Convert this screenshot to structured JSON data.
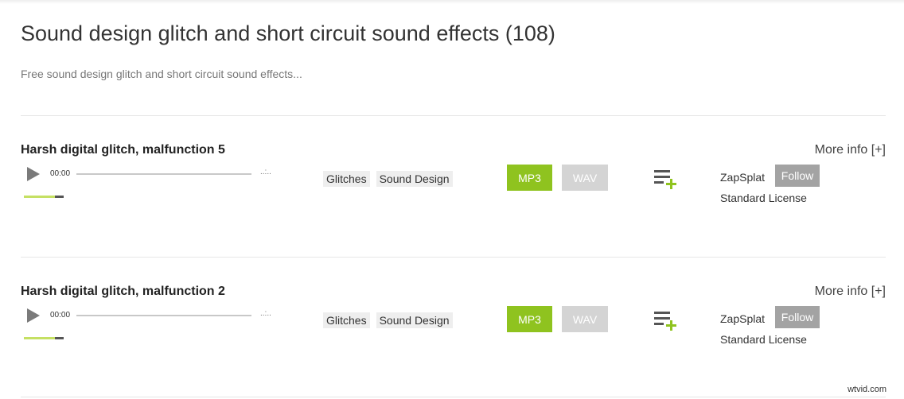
{
  "page": {
    "title": "Sound design glitch and short circuit sound effects (108)",
    "description": "Free sound design glitch and short circuit sound effects..."
  },
  "colors": {
    "accent_green": "#8fc31f",
    "volume_green": "#c5e063",
    "tag_bg": "#eeeeee",
    "wav_button": "#d4d4d4",
    "follow_button": "#a3a3a3"
  },
  "icons": {
    "play": "play-icon",
    "playlist_add": "playlist-add-icon"
  },
  "sounds": [
    {
      "title": "Harsh digital glitch, malfunction 5",
      "more_info": "More info [+]",
      "player": {
        "current_time": "00:00",
        "total_time": "..:..",
        "progress": 0,
        "volume": 0.78
      },
      "tags": [
        "Glitches",
        "Sound Design"
      ],
      "download_mp3": "MP3",
      "download_wav": "WAV",
      "author": "ZapSplat",
      "follow": "Follow",
      "license": "Standard License"
    },
    {
      "title": "Harsh digital glitch, malfunction 2",
      "more_info": "More info [+]",
      "player": {
        "current_time": "00:00",
        "total_time": "..:..",
        "progress": 0,
        "volume": 0.78
      },
      "tags": [
        "Glitches",
        "Sound Design"
      ],
      "download_mp3": "MP3",
      "download_wav": "WAV",
      "author": "ZapSplat",
      "follow": "Follow",
      "license": "Standard License"
    }
  ],
  "watermark": "wtvid.com"
}
